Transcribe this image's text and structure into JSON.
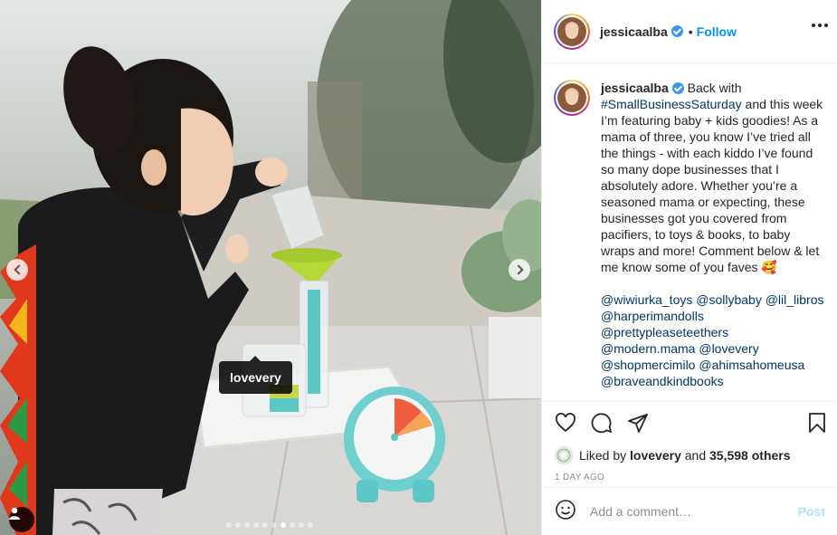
{
  "post": {
    "username": "jessicaalba",
    "header_separator": "•",
    "follow_label": "Follow",
    "photo_tag": "lovevery",
    "carousel": {
      "total": 10,
      "active": 6
    }
  },
  "caption": {
    "username": "jessicaalba",
    "intro": " Back with ",
    "hashtag": "#SmallBusinessSaturday",
    "body": " and this week I’m featuring baby + kids goodies! As a mama of three, you know I’ve tried all the things - with each kiddo I’ve found so many dope businesses that I absolutely adore. Whether you’re a seasoned mama or expecting, these businesses got you covered from pacifiers, to toys & books, to baby wraps and more! Comment below & let me know some of you faves 🥰",
    "mentions": [
      "@wiwiurka_toys",
      "@sollybaby",
      "@lil_libros",
      "@harperimandolls",
      "@prettypleaseteethers",
      "@modern.mama",
      "@lovevery",
      "@shopmercimilo",
      "@ahimsahomeusa",
      "@braveandkindbooks"
    ]
  },
  "likes": {
    "prefix": "Liked by ",
    "first_user": "lovevery",
    "middle": " and ",
    "others": "35,598 others"
  },
  "timestamp": "1 DAY AGO",
  "comment_box": {
    "placeholder": "Add a comment…",
    "post_label": "Post"
  },
  "icons": {
    "like": "heart-icon",
    "comment": "comment-icon",
    "share": "share-icon",
    "save": "bookmark-icon",
    "emoji": "smiley-icon",
    "more": "more-icon",
    "tag": "user-tag-icon"
  },
  "colors": {
    "link": "#00376b",
    "follow": "#0095f6",
    "post_disabled": "#b2dffc",
    "verified": "#3897f0"
  }
}
